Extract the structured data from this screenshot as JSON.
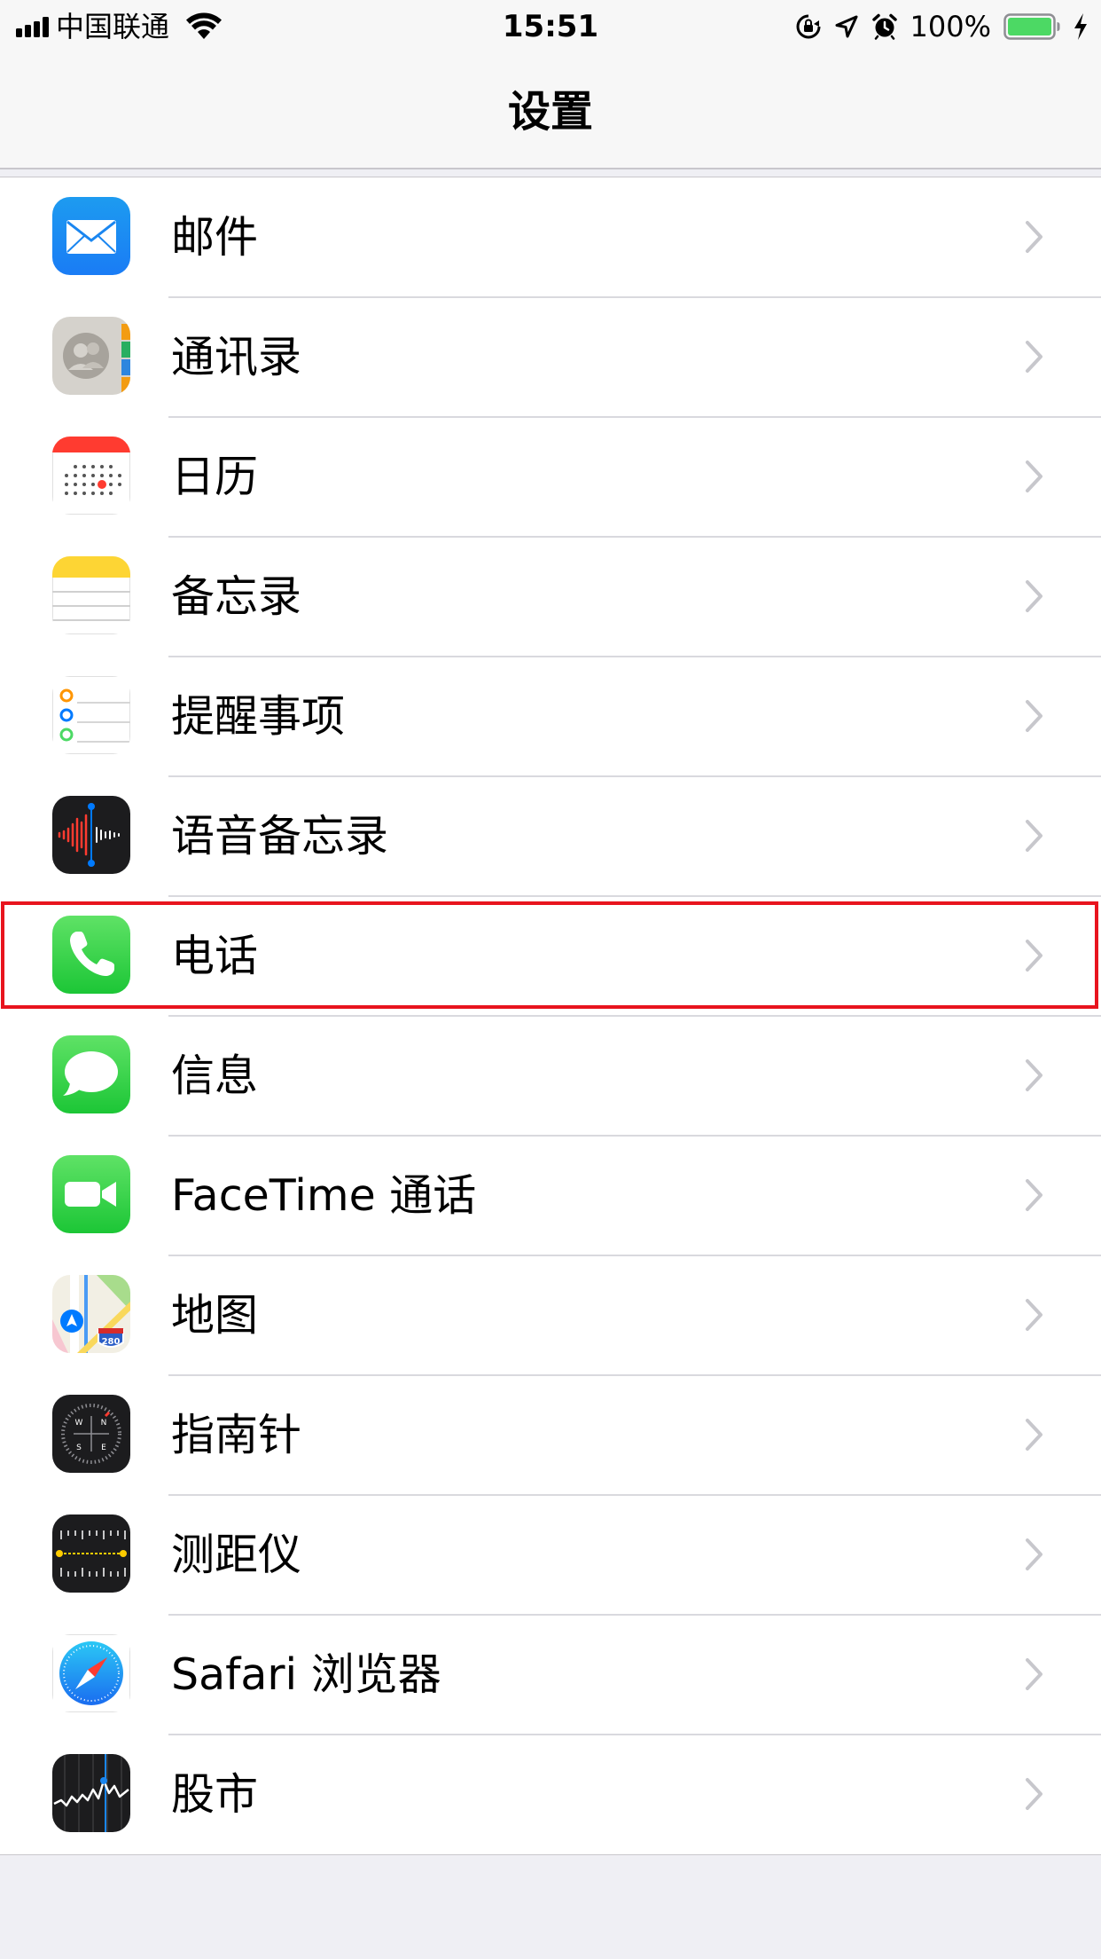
{
  "status_bar": {
    "carrier": "中国联通",
    "time": "15:51",
    "battery_percent": "100%",
    "battery_level": 1.0,
    "icons": [
      "signal-icon",
      "wifi-icon",
      "orientation-lock-icon",
      "location-icon",
      "alarm-icon",
      "battery-icon",
      "charging-icon"
    ]
  },
  "nav": {
    "title": "设置"
  },
  "colors": {
    "battery_fill": "#4cd964",
    "highlight": "#e8141e",
    "chevron": "#c7c7cc",
    "separator": "#d9d9de"
  },
  "list": {
    "items": [
      {
        "label": "邮件",
        "icon": "mail-icon"
      },
      {
        "label": "通讯录",
        "icon": "contacts-icon"
      },
      {
        "label": "日历",
        "icon": "calendar-icon"
      },
      {
        "label": "备忘录",
        "icon": "notes-icon"
      },
      {
        "label": "提醒事项",
        "icon": "reminders-icon"
      },
      {
        "label": "语音备忘录",
        "icon": "voice-memos-icon"
      },
      {
        "label": "电话",
        "icon": "phone-icon",
        "highlighted": true
      },
      {
        "label": "信息",
        "icon": "messages-icon"
      },
      {
        "label": "FaceTime 通话",
        "icon": "facetime-icon"
      },
      {
        "label": "地图",
        "icon": "maps-icon"
      },
      {
        "label": "指南针",
        "icon": "compass-icon"
      },
      {
        "label": "测距仪",
        "icon": "measure-icon"
      },
      {
        "label": "Safari 浏览器",
        "icon": "safari-icon"
      },
      {
        "label": "股市",
        "icon": "stocks-icon"
      }
    ]
  },
  "map_icon_sign": "280"
}
